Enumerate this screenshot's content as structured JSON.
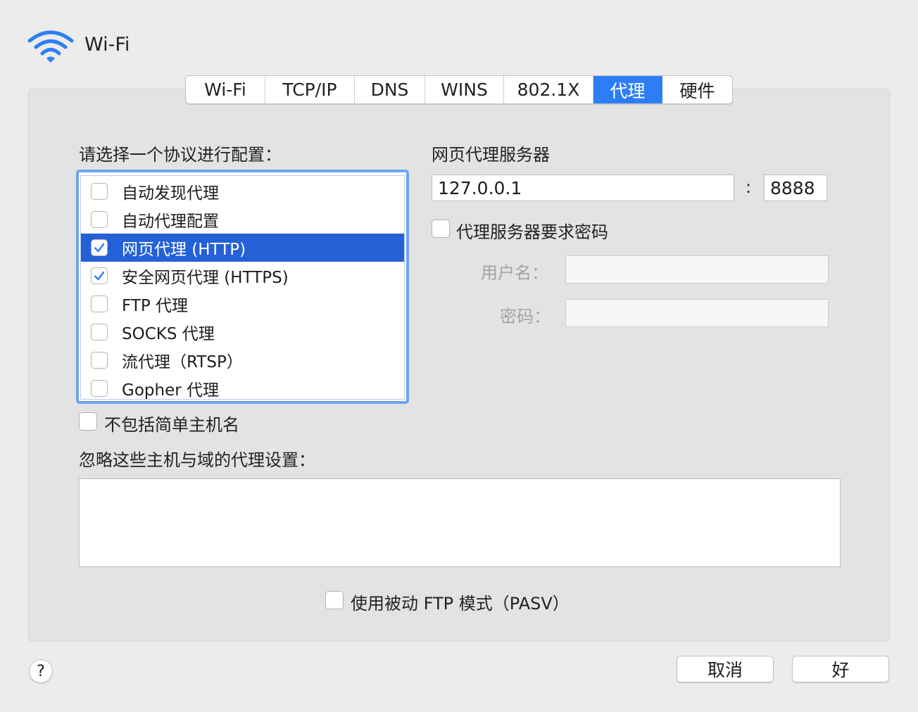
{
  "window": {
    "title": "Wi-Fi",
    "icon": "wifi-icon"
  },
  "tabs": [
    {
      "label": "Wi-Fi",
      "active": false
    },
    {
      "label": "TCP/IP",
      "active": false
    },
    {
      "label": "DNS",
      "active": false
    },
    {
      "label": "WINS",
      "active": false
    },
    {
      "label": "802.1X",
      "active": false
    },
    {
      "label": "代理",
      "active": true
    },
    {
      "label": "硬件",
      "active": false
    }
  ],
  "protocols": {
    "heading": "请选择一个协议进行配置：",
    "items": [
      {
        "label": "自动发现代理",
        "checked": false,
        "selected": false
      },
      {
        "label": "自动代理配置",
        "checked": false,
        "selected": false
      },
      {
        "label": "网页代理 (HTTP)",
        "checked": true,
        "selected": true
      },
      {
        "label": "安全网页代理 (HTTPS)",
        "checked": true,
        "selected": false
      },
      {
        "label": "FTP 代理",
        "checked": false,
        "selected": false
      },
      {
        "label": "SOCKS 代理",
        "checked": false,
        "selected": false
      },
      {
        "label": "流代理（RTSP）",
        "checked": false,
        "selected": false
      },
      {
        "label": "Gopher 代理",
        "checked": false,
        "selected": false
      }
    ]
  },
  "server": {
    "heading": "网页代理服务器",
    "host": "127.0.0.1",
    "separator": ":",
    "port": "8888",
    "require_password_label": "代理服务器要求密码",
    "require_password_checked": false,
    "username_label": "用户名：",
    "username_value": "",
    "password_label": "密码：",
    "password_value": ""
  },
  "exclude_simple_hostnames": {
    "label": "不包括简单主机名",
    "checked": false
  },
  "bypass": {
    "heading": "忽略这些主机与域的代理设置：",
    "value": ""
  },
  "passive_ftp": {
    "label": "使用被动 FTP 模式（PASV）",
    "checked": false
  },
  "buttons": {
    "help": "?",
    "cancel": "取消",
    "ok": "好"
  },
  "colors": {
    "accent": "#2d7ef6",
    "selection": "#2461d6",
    "focus_ring": "#6fa3ec"
  }
}
